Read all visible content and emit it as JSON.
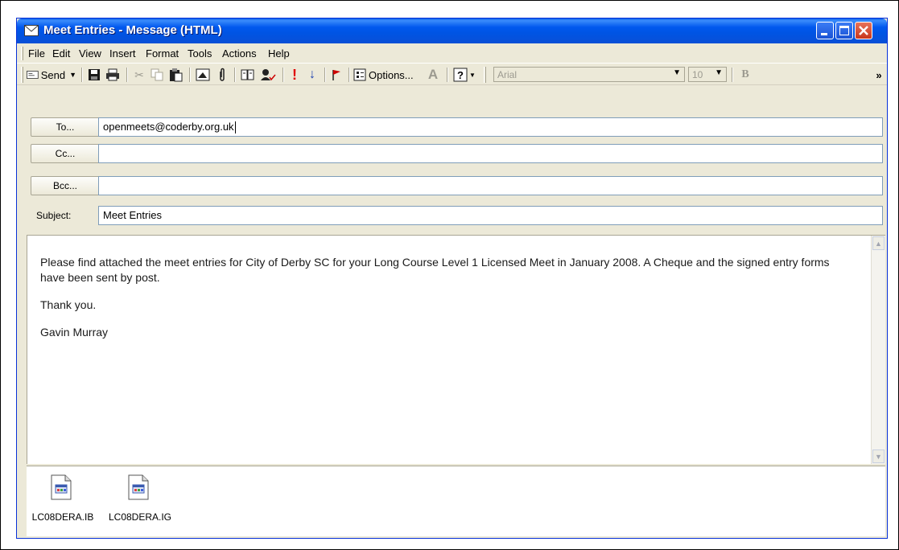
{
  "window": {
    "title": "Meet Entries - Message (HTML)"
  },
  "menu": [
    "File",
    "Edit",
    "View",
    "Insert",
    "Format",
    "Tools",
    "Actions",
    "Help"
  ],
  "toolbar": {
    "send_label": "Send",
    "options_label": "Options...",
    "font_name": "Arial",
    "font_size": "10",
    "bold_label": "B",
    "more_label": "»"
  },
  "header": {
    "to_button": "To...",
    "to_value": "openmeets@coderby.org.uk",
    "cc_button": "Cc...",
    "cc_value": "",
    "bcc_button": "Bcc...",
    "bcc_value": "",
    "subject_label": "Subject:",
    "subject_value": "Meet Entries"
  },
  "body": {
    "paragraphs": [
      "Please find attached the meet entries for City of Derby SC for your Long Course Level 1 Licensed Meet in January 2008.  A Cheque and the signed entry forms have been sent by post.",
      "Thank you.",
      "Gavin Murray"
    ]
  },
  "attachments": [
    {
      "name": "LC08DERA.IB"
    },
    {
      "name": "LC08DERA.IG"
    }
  ]
}
